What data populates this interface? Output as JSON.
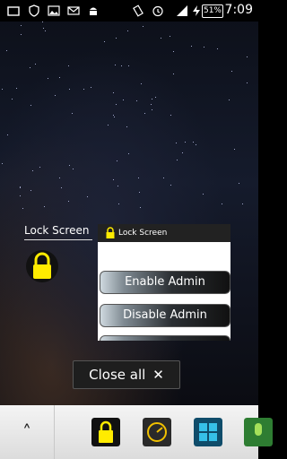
{
  "statusbar": {
    "battery": "51%",
    "time": "7:09"
  },
  "recent_app": {
    "label": "Lock Screen",
    "thumbnail_title": "Lock Screen",
    "enable_admin": "Enable Admin",
    "disable_admin": "Disable Admin"
  },
  "close_all": {
    "label": "Close all",
    "icon": "✕"
  },
  "dock": {
    "up_icon": "˄"
  },
  "colors": {
    "lock_yellow": "#ffeb00",
    "dock_bg": "#e6e6e6"
  }
}
